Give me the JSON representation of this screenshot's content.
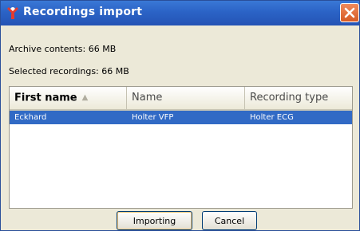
{
  "window": {
    "title": "Recordings import",
    "icon": "app-logo-icon",
    "close_icon": "close-icon",
    "close_color": "#e8602c"
  },
  "info": {
    "archive_contents": "Archive contents: 66 MB",
    "selected_recordings": "Selected recordings: 66 MB"
  },
  "table": {
    "columns": [
      "First name",
      "Name",
      "Recording type"
    ],
    "sorted_column": "First name",
    "sort_icon": "sort-ascending-icon",
    "rows": [
      {
        "first_name": "Eckhard",
        "name": "Holter VFP",
        "recording_type": "Holter ECG",
        "selected": true
      }
    ],
    "selection_color": "#316ac5"
  },
  "buttons": {
    "import": "Importing",
    "cancel": "Cancel"
  }
}
